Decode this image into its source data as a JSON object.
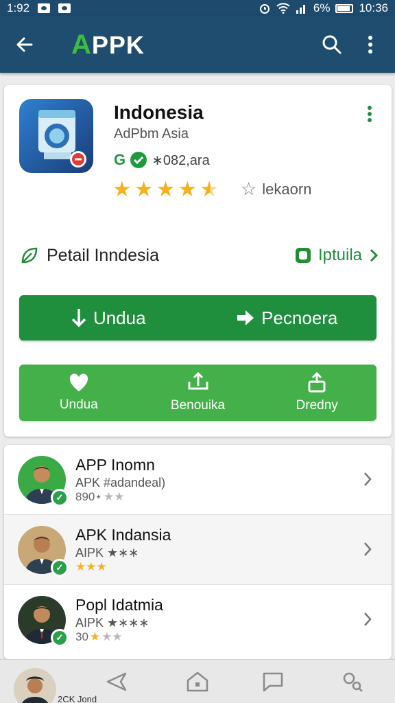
{
  "status_bar": {
    "time_left": "1:92",
    "battery": "6%",
    "time": "10:36"
  },
  "app_bar": {
    "logo_text": "PPK",
    "logo_initial": "A"
  },
  "app": {
    "name": "Indonesia",
    "developer": "AdPbm Asia",
    "meta_prefix": "G",
    "meta_text": "∗082,ara",
    "rating": 4.5,
    "review_label": "lekaorn"
  },
  "detail": {
    "title": "Petail Inndesia",
    "link": "Iptuila"
  },
  "primary_actions": [
    {
      "label": "Undua",
      "icon": "download-arrow-icon"
    },
    {
      "label": "Pecnoera",
      "icon": "right-arrow-icon"
    }
  ],
  "secondary_actions": [
    {
      "label": "Undua",
      "icon": "heart-icon"
    },
    {
      "label": "Benouika",
      "icon": "share-hand-icon"
    },
    {
      "label": "Dredny",
      "icon": "upload-box-icon"
    }
  ],
  "list": [
    {
      "title": "APP Inomn",
      "subtitle": "APK #adandeal)",
      "rating_prefix": "890⋆",
      "stars_on": 0,
      "stars_off": 2,
      "avatar_bg": "#3aaa45"
    },
    {
      "title": "APK Indansia",
      "subtitle": "AIPK ★∗∗",
      "rating_prefix": "",
      "stars_on": 3,
      "stars_off": 0,
      "avatar_bg": "#c9a878"
    },
    {
      "title": "Popl Idatmia",
      "subtitle": "AIPK ★∗∗∗",
      "rating_prefix": "30",
      "stars_on": 1,
      "stars_off": 2,
      "avatar_bg": "#2b3b2a"
    }
  ],
  "bottom_nav": {
    "label": "2CK Jond"
  },
  "colors": {
    "app_bar": "#1f4d70",
    "primary_green": "#1f8e3d",
    "secondary_green": "#44b04a",
    "star": "#f6b21b"
  }
}
